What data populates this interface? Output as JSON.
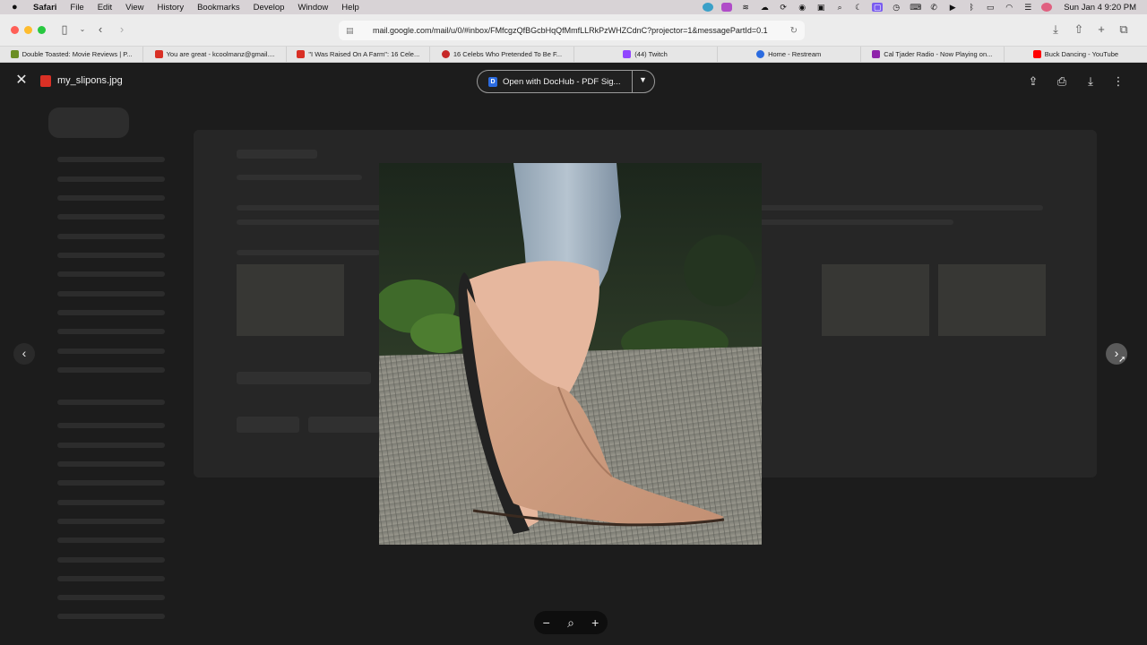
{
  "menubar": {
    "apple": "",
    "items": [
      "Safari",
      "File",
      "Edit",
      "View",
      "History",
      "Bookmarks",
      "Develop",
      "Window",
      "Help"
    ],
    "clock": "Sun Jan 4  9:20 PM"
  },
  "toolbar": {
    "url": "mail.google.com/mail/u/0/#inbox/FMfcgzQfBGcbHqQfMmfLLRkPzWHZCdnC?projector=1&messagePartId=0.1"
  },
  "favorites": [
    {
      "label": "Double Toasted: Movie Reviews | P...",
      "color": "#6b8e23"
    },
    {
      "label": "You are great - kcoolmanz@gmail....",
      "color": "#d93025"
    },
    {
      "label": "\"I Was Raised On A Farm\": 16 Cele...",
      "color": "#d93025"
    },
    {
      "label": "16 Celebs Who Pretended To Be F...",
      "color": "#c62828"
    },
    {
      "label": "(44) Twitch",
      "color": "#9146ff"
    },
    {
      "label": "Home - Restream",
      "color": "#2b6be0"
    },
    {
      "label": "Cal Tjader Radio - Now Playing on...",
      "color": "#8e24aa"
    },
    {
      "label": "Buck Dancing - YouTube",
      "color": "#ff0000"
    }
  ],
  "viewer": {
    "file_name": "my_slipons.jpg",
    "open_with_label": "Open with DocHub - PDF Sig...",
    "open_with_icon_letter": "D",
    "photo_subject": "slip-on-shoe-photo"
  },
  "icons": {
    "close": "✕",
    "prev": "‹",
    "next": "›",
    "zoom_out": "−",
    "zoom": "⌕",
    "zoom_in": "+",
    "add_to_drive": "⇪",
    "print": "⎙",
    "download": "⤓",
    "more": "⋮",
    "dropdown": "▼"
  }
}
